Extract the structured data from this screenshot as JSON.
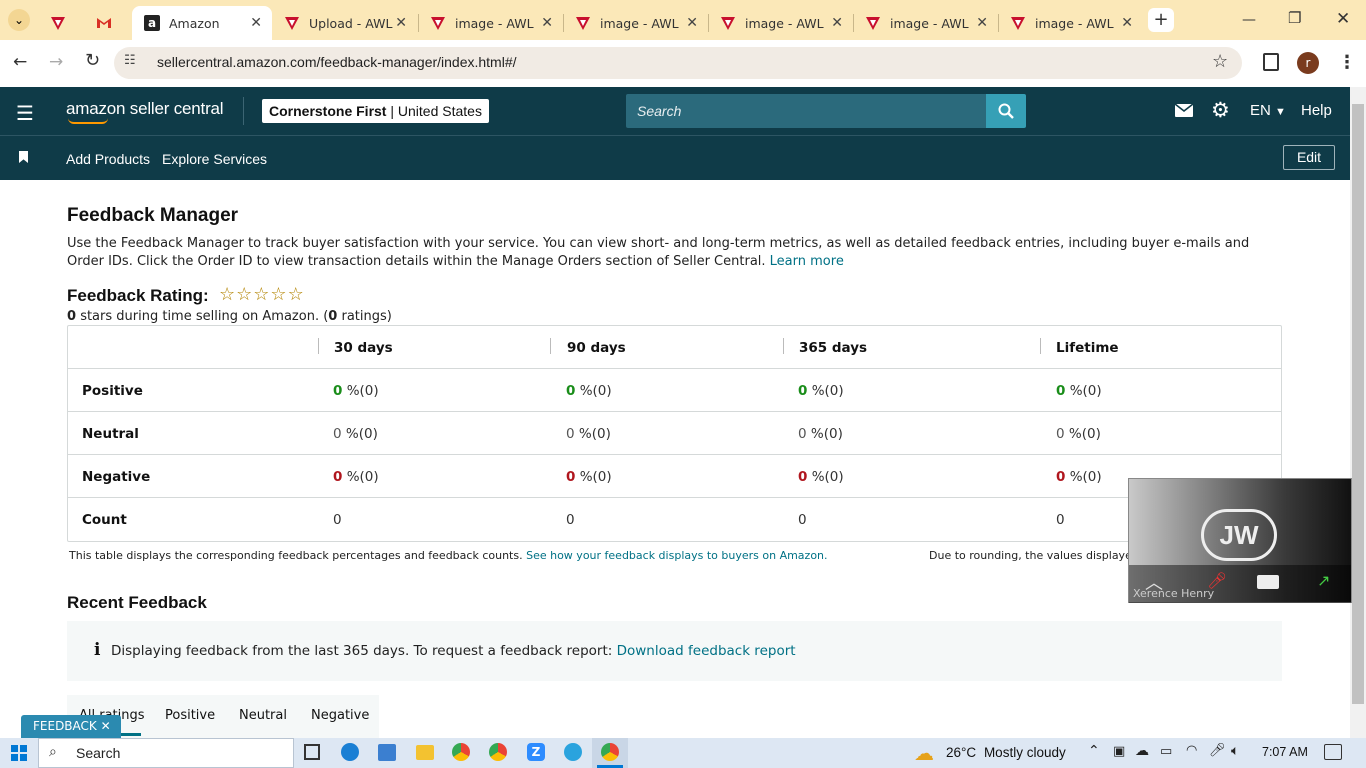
{
  "browser": {
    "tabs": [
      {
        "title": "",
        "icon": "vendor-icon"
      },
      {
        "title": "",
        "icon": "gmail-icon"
      },
      {
        "title": "Amazon",
        "icon": "amazon-icon",
        "active": true
      },
      {
        "title": "Upload - AWL",
        "icon": "vendor-icon"
      },
      {
        "title": "image - AWL",
        "icon": "vendor-icon"
      },
      {
        "title": "image - AWL",
        "icon": "vendor-icon"
      },
      {
        "title": "image - AWL",
        "icon": "vendor-icon"
      },
      {
        "title": "image - AWL",
        "icon": "vendor-icon"
      },
      {
        "title": "image - AWL",
        "icon": "vendor-icon"
      }
    ],
    "url": "sellercentral.amazon.com/feedback-manager/index.html#/",
    "profile_initial": "r"
  },
  "header": {
    "logo": "amazon seller central",
    "account": "Cornerstone First",
    "region": "United States",
    "search_placeholder": "Search",
    "language": "EN",
    "help": "Help"
  },
  "nav": {
    "items": [
      "Add Products",
      "Explore Services"
    ],
    "edit": "Edit"
  },
  "page": {
    "title": "Feedback Manager",
    "description": "Use the Feedback Manager to track buyer satisfaction with your service. You can view short- and long-term metrics, as well as detailed feedback entries, including buyer e-mails and Order IDs. Click the Order ID to view transaction details within the Manage Orders section of Seller Central.",
    "learn_more": "Learn more",
    "rating_label": "Feedback Rating:",
    "stars_filled": 0,
    "stars_total": 5,
    "stars_count": "0",
    "stars_text": "stars during time selling on Amazon.",
    "ratings_count": "0",
    "ratings_word": "ratings"
  },
  "table": {
    "columns": [
      "30 days",
      "90 days",
      "365 days",
      "Lifetime"
    ],
    "rows": [
      {
        "label": "Positive",
        "values": [
          "0",
          "0",
          "0",
          "0"
        ],
        "suffix": [
          "%(0)",
          "%(0)",
          "%(0)",
          "%(0)"
        ]
      },
      {
        "label": "Neutral",
        "values": [
          "0",
          "0",
          "0",
          "0"
        ],
        "suffix": [
          "%(0)",
          "%(0)",
          "%(0)",
          "%(0)"
        ]
      },
      {
        "label": "Negative",
        "values": [
          "0",
          "0",
          "0",
          "0"
        ],
        "suffix": [
          "%(0)",
          "%(0)",
          "%(0)",
          "%(0)"
        ]
      },
      {
        "label": "Count",
        "values": [
          "0",
          "0",
          "0",
          "0"
        ]
      }
    ],
    "footnote": "This table displays the corresponding feedback percentages and feedback counts.",
    "footnote_link": "See how your feedback displays to buyers on Amazon.",
    "rounding_note": "Due to rounding, the values displaye"
  },
  "recent": {
    "title": "Recent Feedback",
    "info": "Displaying feedback from the last 365 days. To request a feedback report:",
    "info_link": "Download feedback report",
    "tabs": [
      "All ratings",
      "Positive",
      "Neutral",
      "Negative"
    ]
  },
  "feedback_button": "FEEDBACK",
  "video_overlay": {
    "name": "Xerence Henry"
  },
  "taskbar": {
    "search": "Search",
    "weather_temp": "26°C",
    "weather_text": "Mostly cloudy",
    "time": "7:07 AM"
  }
}
